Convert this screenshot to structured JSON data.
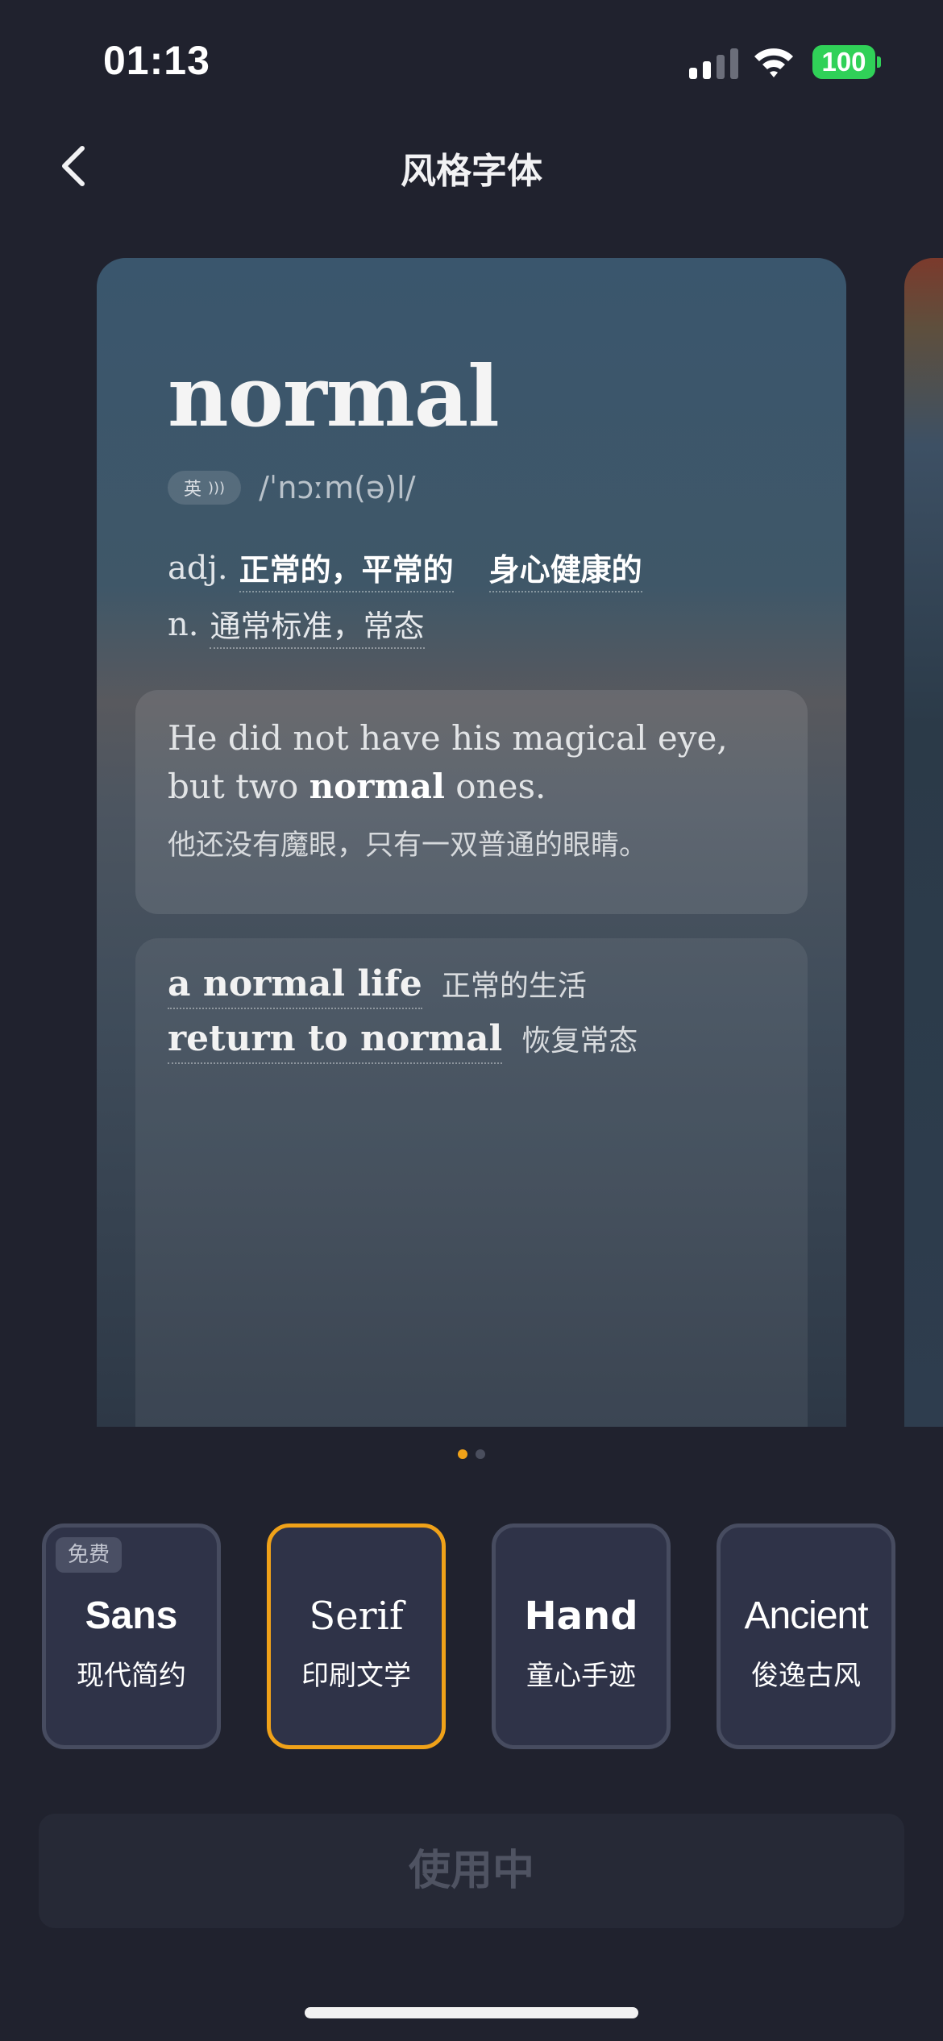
{
  "status_bar": {
    "time": "01:13",
    "battery": "100"
  },
  "nav": {
    "title": "风格字体"
  },
  "card": {
    "word": "normal",
    "lang": "英",
    "phonetic": "/ˈnɔːm(ə)l/",
    "definitions": [
      {
        "pos": "adj.",
        "meanings": [
          "正常的，平常的",
          "身心健康的"
        ]
      },
      {
        "pos": "n.",
        "meanings": [
          "通常标准，常态"
        ]
      }
    ],
    "example": {
      "en_before": "He did not have his magical eye, but two ",
      "en_keyword": "normal",
      "en_after": " ones.",
      "zh": "他还没有魔眼，只有一双普通的眼睛。"
    },
    "phrases": [
      {
        "en": "a normal life",
        "zh": "正常的生活"
      },
      {
        "en": "return to normal",
        "zh": "恢复常态"
      }
    ]
  },
  "pager": {
    "total": 2,
    "active": 1
  },
  "font_options": [
    {
      "name": "Sans",
      "subtitle": "现代简约",
      "badge": "免费",
      "selected": false
    },
    {
      "name": "Serif",
      "subtitle": "印刷文学",
      "badge": "",
      "selected": true
    },
    {
      "name": "Hand",
      "subtitle": "童心手迹",
      "badge": "",
      "selected": false
    },
    {
      "name": "Ancient",
      "subtitle": "俊逸古风",
      "badge": "",
      "selected": false
    }
  ],
  "action_button": {
    "label": "使用中"
  },
  "colors": {
    "accent": "#f0a219",
    "background": "#20222e",
    "option_bg": "#2f3348",
    "battery": "#30d158"
  }
}
